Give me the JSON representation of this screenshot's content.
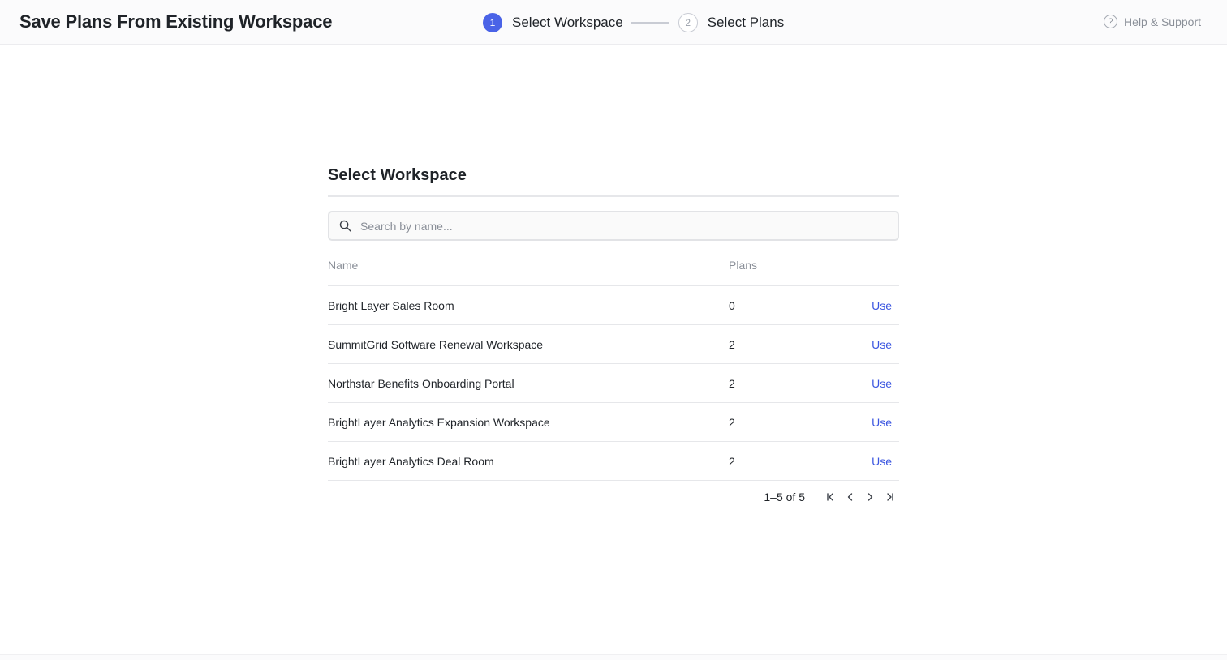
{
  "header": {
    "title": "Save Plans From Existing Workspace",
    "steps": [
      {
        "number": "1",
        "label": "Select Workspace",
        "state": "active"
      },
      {
        "number": "2",
        "label": "Select Plans",
        "state": "inactive"
      }
    ],
    "help_label": "Help & Support",
    "help_icon": "question-circle-icon"
  },
  "panel": {
    "title": "Select Workspace",
    "search": {
      "placeholder": "Search by name...",
      "value": "",
      "icon": "search-icon"
    },
    "columns": {
      "name": "Name",
      "plans": "Plans"
    },
    "rows": [
      {
        "name": "Bright Layer Sales Room",
        "plans": "0",
        "action": "Use"
      },
      {
        "name": "SummitGrid Software Renewal Workspace",
        "plans": "2",
        "action": "Use"
      },
      {
        "name": "Northstar Benefits Onboarding Portal",
        "plans": "2",
        "action": "Use"
      },
      {
        "name": "BrightLayer Analytics Expansion Workspace",
        "plans": "2",
        "action": "Use"
      },
      {
        "name": "BrightLayer Analytics Deal Room",
        "plans": "2",
        "action": "Use"
      }
    ],
    "pagination": {
      "range": "1–5 of 5",
      "icons": [
        "first-page-icon",
        "previous-page-icon",
        "next-page-icon",
        "last-page-icon"
      ]
    }
  },
  "colors": {
    "accent": "#4a63e7",
    "link": "#3b56e0",
    "muted_text": "#8a8f98",
    "divider": "#e6e7ea"
  }
}
